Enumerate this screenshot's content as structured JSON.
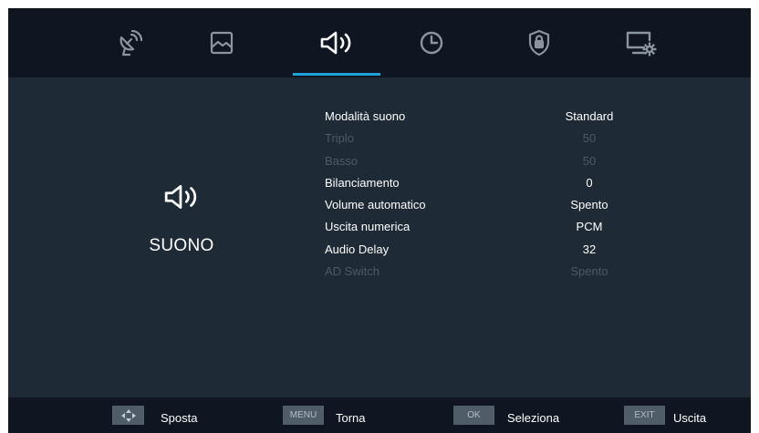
{
  "tabs": [
    {
      "name": "satellite-dish-icon",
      "active": false
    },
    {
      "name": "picture-icon",
      "active": false
    },
    {
      "name": "speaker-icon",
      "active": true
    },
    {
      "name": "clock-icon",
      "active": false
    },
    {
      "name": "lock-shield-icon",
      "active": false
    },
    {
      "name": "monitor-settings-icon",
      "active": false
    }
  ],
  "colors": {
    "background": "#1e2a36",
    "bar": "#0f1622",
    "accent": "#1fa3dd",
    "disabled_text": "#4a5a68"
  },
  "left_panel": {
    "icon": "speaker-icon",
    "title": "SUONO"
  },
  "menu": {
    "rows": [
      {
        "label": "Modalità suono",
        "value": "Standard",
        "enabled": true
      },
      {
        "label": "Triplo",
        "value": "50",
        "enabled": false
      },
      {
        "label": "Basso",
        "value": "50",
        "enabled": false
      },
      {
        "label": "Bilanciamento",
        "value": "0",
        "enabled": true
      },
      {
        "label": "Volume automatico",
        "value": "Spento",
        "enabled": true
      },
      {
        "label": "Uscita numerica",
        "value": "PCM",
        "enabled": true
      },
      {
        "label": "Audio Delay",
        "value": "32",
        "enabled": true
      },
      {
        "label": "AD Switch",
        "value": "Spento",
        "enabled": false
      }
    ]
  },
  "footer": {
    "move": {
      "key_icon": "arrows-icon",
      "label": "Sposta"
    },
    "back": {
      "key": "MENU",
      "label": "Torna"
    },
    "select": {
      "key": "OK",
      "label": "Seleziona"
    },
    "exit": {
      "key": "EXIT",
      "label": "Uscita"
    }
  }
}
